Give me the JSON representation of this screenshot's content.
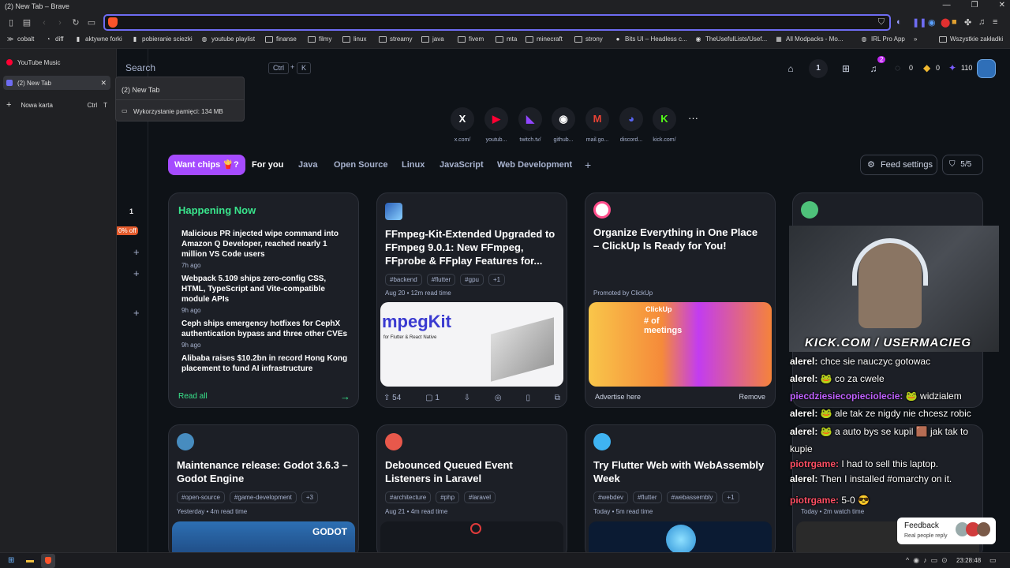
{
  "window": {
    "title": "(2) New Tab – Brave"
  },
  "toolbar": {
    "url": ""
  },
  "bookmarks": [
    {
      "label": "cobalt",
      "icon": "cobalt-icon"
    },
    {
      "label": "diff",
      "icon": "diff-icon"
    },
    {
      "label": "aktywne forki",
      "icon": "bookmark-icon"
    },
    {
      "label": "pobieranie sciezki",
      "icon": "bookmark-icon"
    },
    {
      "label": "youtube playlist",
      "icon": "globe-icon"
    },
    {
      "label": "finanse",
      "icon": "folder-icon"
    },
    {
      "label": "filmy",
      "icon": "folder-icon"
    },
    {
      "label": "linux",
      "icon": "folder-icon"
    },
    {
      "label": "streamy",
      "icon": "folder-icon"
    },
    {
      "label": "java",
      "icon": "folder-icon"
    },
    {
      "label": "fivem",
      "icon": "folder-icon"
    },
    {
      "label": "mta",
      "icon": "folder-icon"
    },
    {
      "label": "minecraft",
      "icon": "folder-icon"
    },
    {
      "label": "strony",
      "icon": "folder-icon"
    },
    {
      "label": "Bits UI – Headless c...",
      "icon": "bits-icon"
    },
    {
      "label": "TheUsefulLists/Usef...",
      "icon": "github-icon"
    },
    {
      "label": "All Modpacks - Mo...",
      "icon": "modpacks-icon"
    },
    {
      "label": "IRL Pro App",
      "icon": "globe-icon"
    }
  ],
  "bookmarks_overflow": "»",
  "all_bookmarks": "Wszystkie zakładki",
  "sidebar": {
    "tabs": [
      {
        "label": "YouTube Music"
      },
      {
        "label": "(2) New Tab"
      }
    ],
    "new_tab": "Nowa karta",
    "new_tab_shortcut_ctrl": "Ctrl",
    "new_tab_shortcut_key": "T"
  },
  "tooltip": {
    "title": "(2) New Tab",
    "memory": "Wykorzystanie pamięci: 134 MB"
  },
  "search": {
    "placeholder": "Search",
    "k1": "Ctrl",
    "plus": "+",
    "k2": "K"
  },
  "header": {
    "streak": "1",
    "notif_count": "2",
    "reputation": "0",
    "gems": "0",
    "cores": "110"
  },
  "shortcuts": [
    {
      "label": "x.com/",
      "glyph": "X",
      "color": "#ffffff"
    },
    {
      "label": "youtub...",
      "glyph": "▶",
      "color": "#ff0033"
    },
    {
      "label": "twitch.tv/",
      "glyph": "◣",
      "color": "#9146ff"
    },
    {
      "label": "github...",
      "glyph": "◉",
      "color": "#ffffff"
    },
    {
      "label": "mail.go...",
      "glyph": "M",
      "color": "#ea4335"
    },
    {
      "label": "discord...",
      "glyph": "◕",
      "color": "#5865f2"
    },
    {
      "label": "kick.com/",
      "glyph": "K",
      "color": "#53fc18"
    }
  ],
  "shortcut_more": "···",
  "chips": [
    "Want chips 🍟?",
    "For you",
    "Java",
    "Open Source",
    "Linux",
    "JavaScript",
    "Web Development"
  ],
  "chip_add": "+",
  "feed_settings": "Feed settings",
  "feed_counter": "5/5",
  "leftnav": {
    "badge_num": "1",
    "promo": "0% off"
  },
  "happening": {
    "title": "Happening Now",
    "items": [
      {
        "title": "Malicious PR injected wipe command into Amazon Q Developer, reached nearly 1 million VS Code users",
        "ago": "7h ago"
      },
      {
        "title": "Webpack 5.109 ships zero-config CSS, HTML, TypeScript and Vite-compatible module APIs",
        "ago": "9h ago"
      },
      {
        "title": "Ceph ships emergency hotfixes for CephX authentication bypass and three other CVEs",
        "ago": "9h ago"
      },
      {
        "title": "Alibaba raises $10.2bn in record Hong Kong placement to fund AI infrastructure",
        "ago": ""
      }
    ],
    "read_all": "Read all",
    "arrow": "→"
  },
  "cards": [
    {
      "title": "FFmpeg-Kit-Extended Upgraded to FFmpeg 9.0.1: New FFmpeg, FFprobe & FFplay Features for...",
      "tags": [
        "#backend",
        "#flutter",
        "#gpu",
        "+1"
      ],
      "meta": "Aug 20 • 12m read time",
      "upvotes": "54",
      "comments": "1",
      "image_text": "mpegKit",
      "image_sub": "for Flutter & React Native"
    },
    {
      "title": "Organize Everything in One Place – ClickUp Is Ready for You!",
      "promo": "Promoted by ClickUp",
      "ad_label": "Advertise here",
      "remove": "Remove",
      "image_title": "ClickUp",
      "image_text": "# of meetings"
    },
    {
      "title": "Maintenance release: Godot 3.6.3 – Godot Engine",
      "tags": [
        "#open-source",
        "#game-development",
        "+3"
      ],
      "meta": "Yesterday • 4m read time",
      "image_text": "GODOT"
    },
    {
      "title": "Debounced Queued Event Listeners in Laravel",
      "tags": [
        "#architecture",
        "#php",
        "#laravel"
      ],
      "meta": "Aug 21 • 4m read time"
    },
    {
      "title": "Try Flutter Web with WebAssembly Week",
      "tags": [
        "#webdev",
        "#flutter",
        "#webassembly",
        "+1"
      ],
      "meta": "Today • 5m read time"
    },
    {
      "meta": "Today • 2m watch time"
    }
  ],
  "stream": {
    "overlay": "KICK.COM / USERMACIEG",
    "chat": [
      {
        "user": "alerel:",
        "text": "chce sie nauczyc gotowac",
        "color": "#ffffff"
      },
      {
        "user": "alerel:",
        "text": "🐸 co za cwele",
        "color": "#ffffff"
      },
      {
        "user": "piecdziesiecopieciolecie:",
        "text": "🐸 widzialem",
        "color": "#c061ff"
      },
      {
        "user": "alerel:",
        "text": "🐸 ale tak ze nigdy nie chcesz robic",
        "color": "#ffffff"
      },
      {
        "user": "alerel:",
        "text": "🐸 a auto bys se kupil 🟫 jak tak to",
        "color": "#ffffff"
      },
      {
        "user": "",
        "text": "kupie",
        "color": "#ffffff"
      },
      {
        "user": "piotrgame:",
        "text": "I had to sell this laptop.",
        "color": "#ff4f64"
      },
      {
        "user": "alerel:",
        "text": "Then I installed #omarchy on it.",
        "color": "#ffffff"
      },
      {
        "user": "piotrgame:",
        "text": "5-0 😎",
        "color": "#ff4f64"
      }
    ]
  },
  "feedback": {
    "title": "Feedback",
    "sub": "Real people reply"
  },
  "taskbar": {
    "time": "23:28:48"
  },
  "colors": {
    "accent": "#6e6cf2",
    "chip_active": "#a54bff",
    "happening": "#39e58c",
    "card_bg": "#1c1f26"
  }
}
